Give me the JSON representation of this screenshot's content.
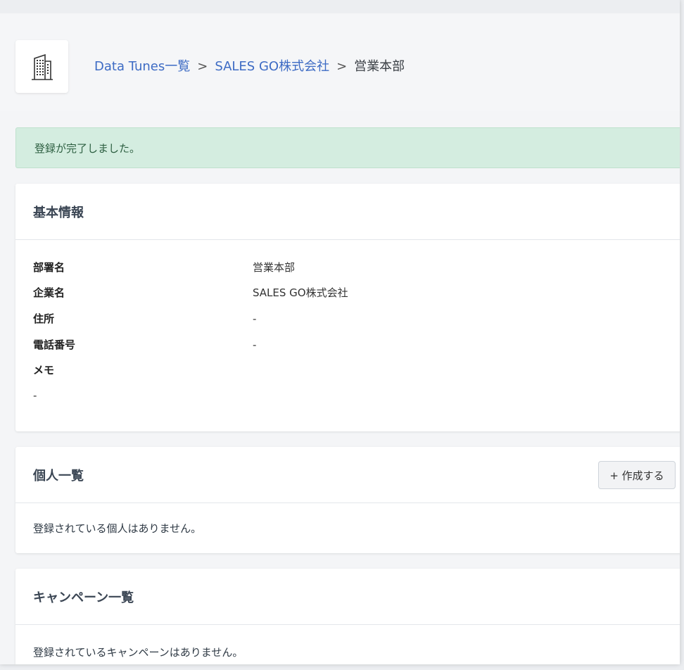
{
  "breadcrumb": {
    "items": [
      "Data Tunes一覧",
      "SALES GO株式会社",
      "営業本部"
    ],
    "separator": ">"
  },
  "alert": {
    "message": "登録が完了しました。"
  },
  "basic_info": {
    "title": "基本情報",
    "fields": [
      {
        "label": "部署名",
        "value": "営業本部"
      },
      {
        "label": "企業名",
        "value": "SALES GO株式会社"
      },
      {
        "label": "住所",
        "value": "-"
      },
      {
        "label": "電話番号",
        "value": "-"
      }
    ],
    "memo_label": "メモ",
    "memo_value": "-"
  },
  "individuals": {
    "title": "個人一覧",
    "create_button": "+ 作成する",
    "empty_message": "登録されている個人はありません。"
  },
  "campaigns": {
    "title": "キャンペーン一覧",
    "empty_message": "登録されているキャンペーンはありません。"
  },
  "colors": {
    "link": "#3d6bc4",
    "alert_bg": "#d4ede0",
    "alert_text": "#2d5f41"
  },
  "icons": {
    "logo": "building-icon"
  }
}
